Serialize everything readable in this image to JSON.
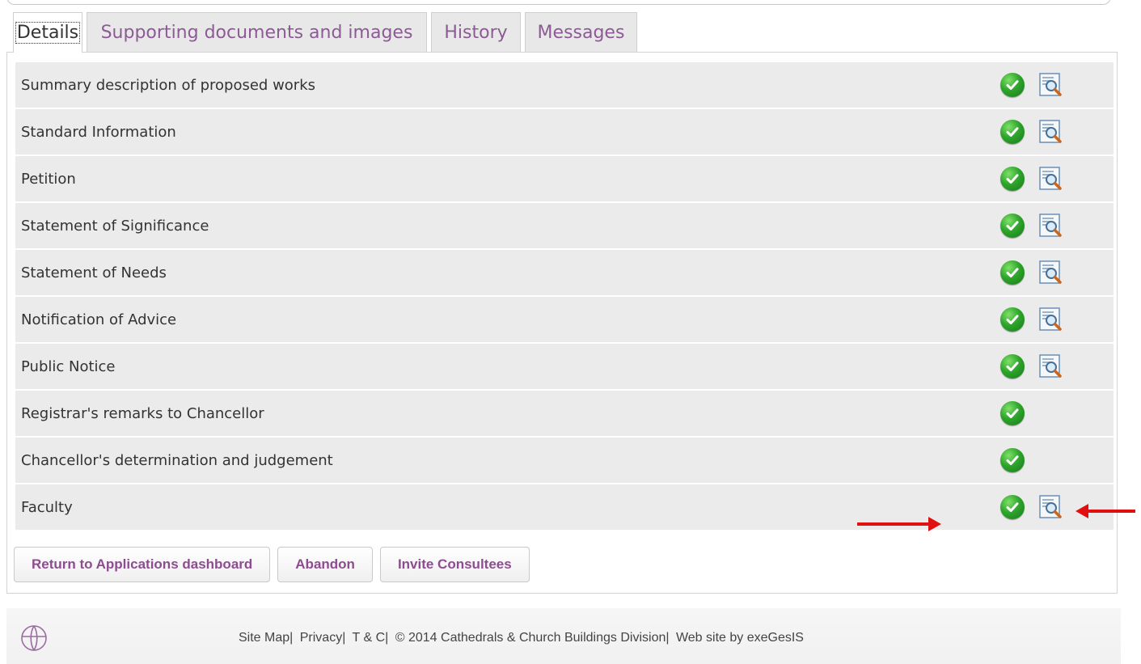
{
  "tabs": [
    {
      "label": "Details",
      "active": true
    },
    {
      "label": "Supporting documents and images",
      "active": false
    },
    {
      "label": "History",
      "active": false
    },
    {
      "label": "Messages",
      "active": false
    }
  ],
  "rows": [
    {
      "label": "Summary description of proposed works",
      "status": "complete",
      "view": true
    },
    {
      "label": "Standard Information",
      "status": "complete",
      "view": true
    },
    {
      "label": "Petition",
      "status": "complete",
      "view": true
    },
    {
      "label": "Statement of Significance",
      "status": "complete",
      "view": true
    },
    {
      "label": "Statement of Needs",
      "status": "complete",
      "view": true
    },
    {
      "label": "Notification of Advice",
      "status": "complete",
      "view": true
    },
    {
      "label": "Public Notice",
      "status": "complete",
      "view": true
    },
    {
      "label": "Registrar's remarks to Chancellor",
      "status": "complete",
      "view": false
    },
    {
      "label": "Chancellor's determination and judgement",
      "status": "complete",
      "view": false
    },
    {
      "label": "Faculty",
      "status": "complete",
      "view": true
    }
  ],
  "actions": {
    "return_label": "Return to Applications dashboard",
    "abandon_label": "Abandon",
    "invite_label": "Invite Consultees"
  },
  "footer": {
    "site_map": "Site Map|",
    "privacy": "Privacy|",
    "tc": "T & C|",
    "copyright": "© 2014 Cathedrals & Church Buildings Division|",
    "credit": "Web site by exeGesIS"
  },
  "colors": {
    "tab_text": "#8c5a94",
    "button_text": "#8c4d8f",
    "row_bg": "#ebebeb",
    "check_green": "#2ea52b",
    "annotation_arrow": "#e01010"
  },
  "icons": {
    "status": "check-circle-icon",
    "view": "document-magnifier-icon",
    "logo": "church-cross-logo-icon"
  }
}
